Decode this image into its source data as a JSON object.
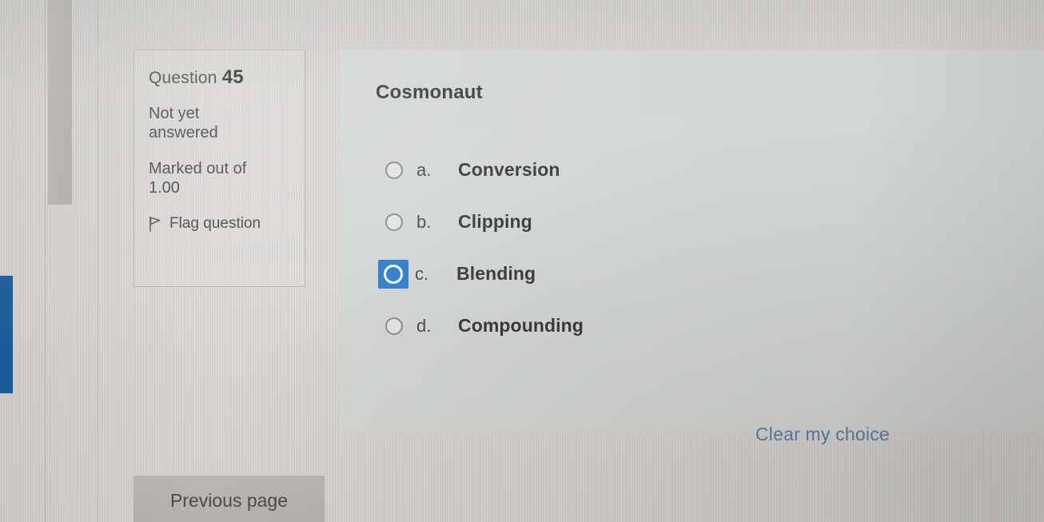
{
  "question_info": {
    "number_label": "Question",
    "number": "45",
    "state": "Not yet answered",
    "grade_label": "Marked out of",
    "grade_value": "1.00",
    "flag_label": "Flag question",
    "flag_icon": "flag-icon"
  },
  "question": {
    "text": "Cosmonaut",
    "options": [
      {
        "letter": "a.",
        "text": "Conversion",
        "selected": false
      },
      {
        "letter": "b.",
        "text": "Clipping",
        "selected": false
      },
      {
        "letter": "c.",
        "text": "Blending",
        "selected": true
      },
      {
        "letter": "d.",
        "text": "Compounding",
        "selected": false
      }
    ],
    "clear_choice_label": "Clear my choice"
  },
  "navigation": {
    "previous_page_label": "Previous page"
  },
  "colors": {
    "accent_blue": "#2f7fd0",
    "link_blue": "#5d7fa3",
    "marker_blue": "#1a5fa0",
    "panel_bg": "#d3d7d4",
    "page_bg": "#d8d5d2",
    "button_bg": "#b7b4b0"
  }
}
